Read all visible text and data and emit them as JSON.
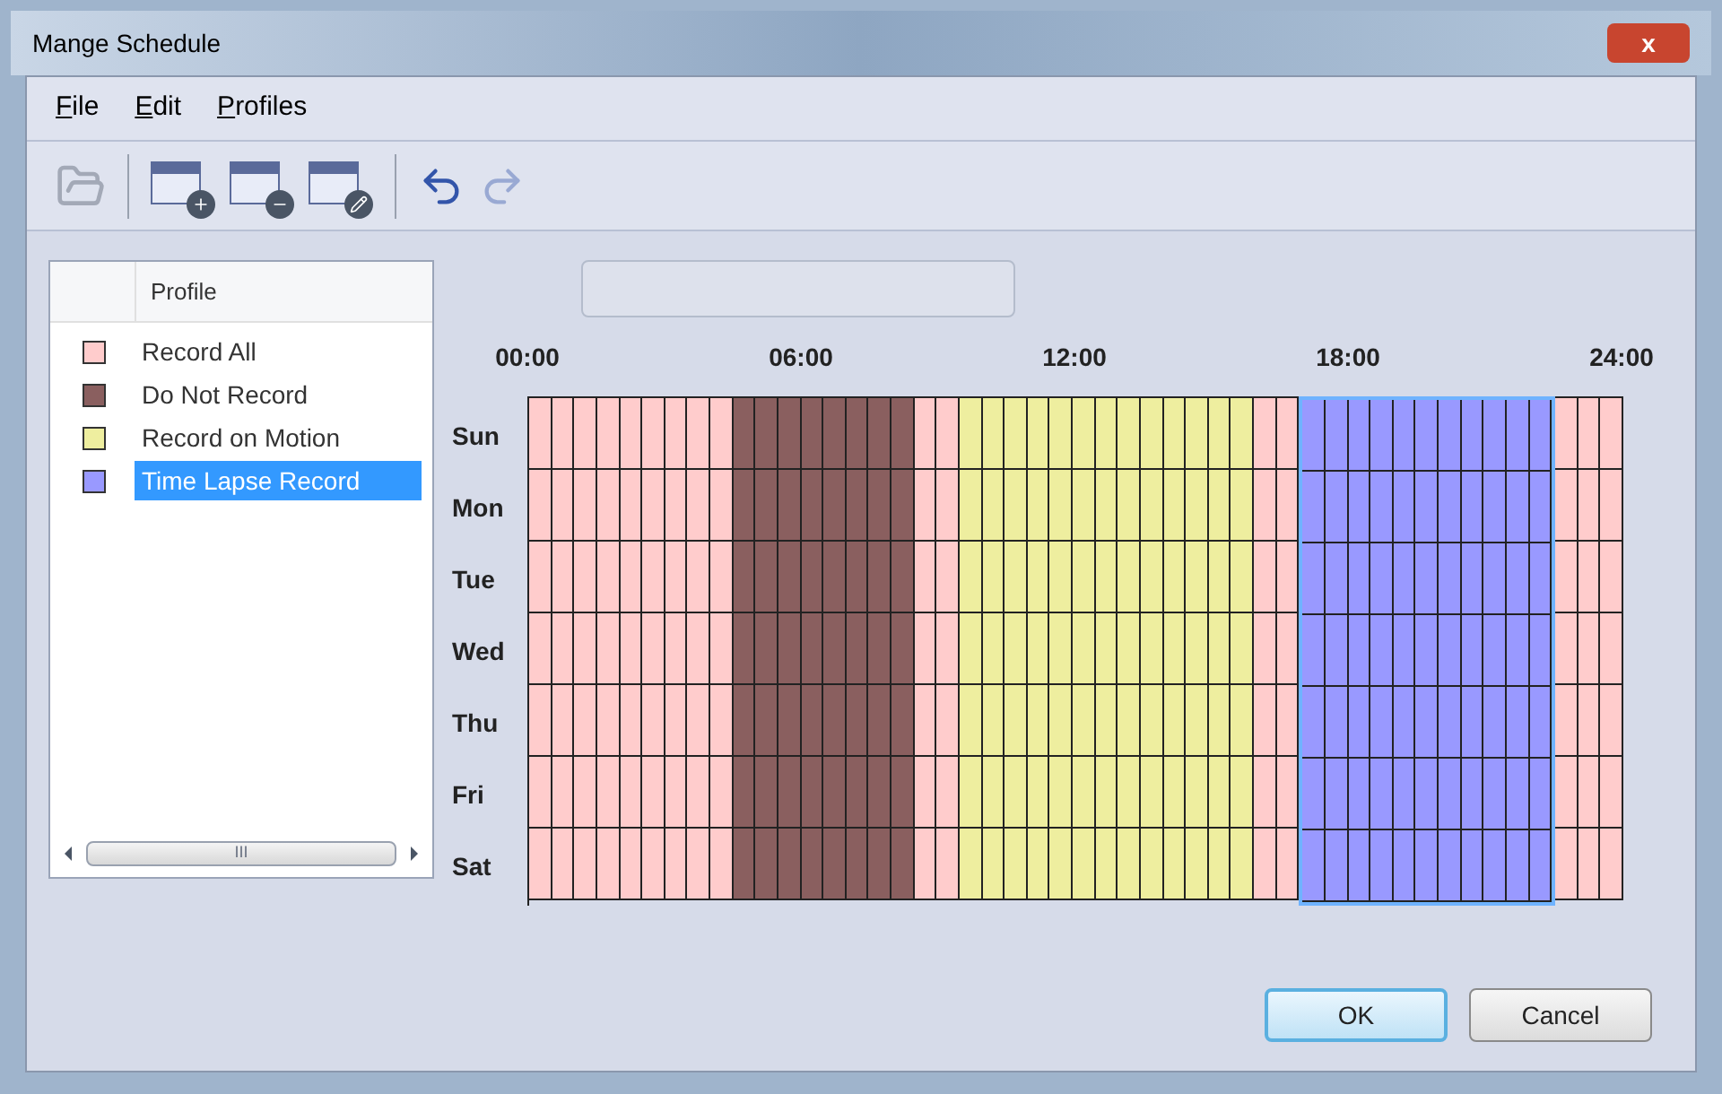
{
  "window": {
    "title": "Mange Schedule",
    "close": "x"
  },
  "menu": [
    {
      "label": "File"
    },
    {
      "label": "Edit"
    },
    {
      "label": "Profiles"
    }
  ],
  "toolbar": [
    {
      "kind": "open",
      "disabled": true
    },
    {
      "kind": "separator"
    },
    {
      "kind": "add",
      "disabled": false
    },
    {
      "kind": "remove",
      "disabled": false
    },
    {
      "kind": "edit",
      "disabled": false
    },
    {
      "kind": "separator"
    },
    {
      "kind": "undo",
      "disabled": false
    },
    {
      "kind": "redo",
      "disabled": true
    }
  ],
  "profiles": {
    "column": "Profile",
    "items": [
      {
        "label": "Record All",
        "color": "#ffcccc",
        "selected": false
      },
      {
        "label": "Do Not Record",
        "color": "#8a5f5f",
        "selected": false
      },
      {
        "label": "Record on Motion",
        "color": "#eeee9f",
        "selected": false
      },
      {
        "label": "Time Lapse Record",
        "color": "#9999ff",
        "selected": true
      }
    ],
    "scrollbar_grip": "III"
  },
  "schedule": {
    "time_labels": [
      "00:00",
      "06:00",
      "12:00",
      "18:00",
      "24:00"
    ],
    "days": [
      "Sun",
      "Mon",
      "Tue",
      "Wed",
      "Thu",
      "Fri",
      "Sat"
    ],
    "slots": [
      {
        "color": "#ffcccc",
        "selected": false
      },
      {
        "color": "#ffcccc",
        "selected": false
      },
      {
        "color": "#ffcccc",
        "selected": false
      },
      {
        "color": "#ffcccc",
        "selected": false
      },
      {
        "color": "#ffcccc",
        "selected": false
      },
      {
        "color": "#ffcccc",
        "selected": false
      },
      {
        "color": "#ffcccc",
        "selected": false
      },
      {
        "color": "#ffcccc",
        "selected": false
      },
      {
        "color": "#ffcccc",
        "selected": false
      },
      {
        "color": "#8a5f5f",
        "selected": false
      },
      {
        "color": "#8a5f5f",
        "selected": false
      },
      {
        "color": "#8a5f5f",
        "selected": false
      },
      {
        "color": "#8a5f5f",
        "selected": false
      },
      {
        "color": "#8a5f5f",
        "selected": false
      },
      {
        "color": "#8a5f5f",
        "selected": false
      },
      {
        "color": "#8a5f5f",
        "selected": false
      },
      {
        "color": "#8a5f5f",
        "selected": false
      },
      {
        "color": "#ffcccc",
        "selected": false
      },
      {
        "color": "#ffcccc",
        "selected": false
      },
      {
        "color": "#eeee9f",
        "selected": false
      },
      {
        "color": "#eeee9f",
        "selected": false
      },
      {
        "color": "#eeee9f",
        "selected": false
      },
      {
        "color": "#eeee9f",
        "selected": false
      },
      {
        "color": "#eeee9f",
        "selected": false
      },
      {
        "color": "#eeee9f",
        "selected": false
      },
      {
        "color": "#eeee9f",
        "selected": false
      },
      {
        "color": "#eeee9f",
        "selected": false
      },
      {
        "color": "#eeee9f",
        "selected": false
      },
      {
        "color": "#eeee9f",
        "selected": false
      },
      {
        "color": "#eeee9f",
        "selected": false
      },
      {
        "color": "#eeee9f",
        "selected": false
      },
      {
        "color": "#eeee9f",
        "selected": false
      },
      {
        "color": "#ffcccc",
        "selected": false
      },
      {
        "color": "#ffcccc",
        "selected": false
      },
      {
        "color": "#9999ff",
        "selected": true
      },
      {
        "color": "#9999ff",
        "selected": true
      },
      {
        "color": "#9999ff",
        "selected": true
      },
      {
        "color": "#9999ff",
        "selected": true
      },
      {
        "color": "#9999ff",
        "selected": true
      },
      {
        "color": "#9999ff",
        "selected": true
      },
      {
        "color": "#9999ff",
        "selected": true
      },
      {
        "color": "#9999ff",
        "selected": true
      },
      {
        "color": "#9999ff",
        "selected": true
      },
      {
        "color": "#9999ff",
        "selected": true
      },
      {
        "color": "#9999ff",
        "selected": true
      },
      {
        "color": "#ffcccc",
        "selected": false
      },
      {
        "color": "#ffcccc",
        "selected": false
      },
      {
        "color": "#ffcccc",
        "selected": false
      }
    ]
  },
  "buttons": [
    {
      "label": "OK",
      "default": true
    },
    {
      "label": "Cancel",
      "default": false
    }
  ]
}
